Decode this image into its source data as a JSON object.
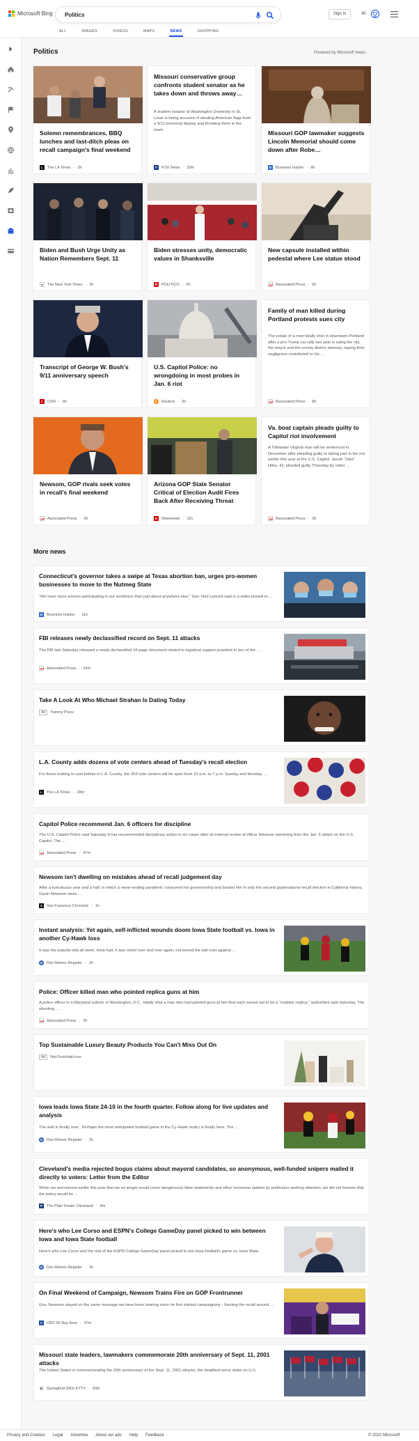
{
  "header": {
    "logo_text": "Microsoft Bing",
    "search_value": "Politics",
    "sign_in": "Sign in",
    "rewards_count": "40",
    "tabs": [
      {
        "label": "ALL"
      },
      {
        "label": "IMAGES"
      },
      {
        "label": "VIDEOS"
      },
      {
        "label": "MAPS"
      },
      {
        "label": "NEWS"
      },
      {
        "label": "SHOPPING"
      }
    ],
    "active_tab": "NEWS"
  },
  "sidebar": {
    "items": [
      "expand-icon",
      "home-icon",
      "tools-icon",
      "flag-icon",
      "location-icon",
      "globe-icon",
      "chart-icon",
      "rocket-icon",
      "film-icon",
      "bank-icon",
      "card-icon"
    ]
  },
  "main": {
    "section_title": "Politics",
    "powered_by": "Powered by Microsoft News",
    "more_title": "More news"
  },
  "cards": [
    {
      "title": "Solemn remembrances, BBQ lunches and last-ditch pleas on recall campaign's final weekend",
      "source": "The LA Times",
      "time": "2h"
    },
    {
      "title": "Missouri conservative group confronts student senator as he takes down and throws away…",
      "desc": "A student senator at Washington University in St. Louis is being accused of stealing American flags from a 9/11 memorial display and throwing them in the trash.",
      "source": "FOX News",
      "time": "33m"
    },
    {
      "title": "Missouri GOP lawmaker suggests Lincoln Memorial should come down after Robe…",
      "source": "Business Insider",
      "time": "9h"
    },
    {
      "title": "Biden and Bush Urge Unity as Nation Remembers Sept. 11",
      "source": "The New York Times",
      "time": "3h"
    },
    {
      "title": "Biden stresses unity, democratic values in Shanksville",
      "source": "POLITICO",
      "time": "6h"
    },
    {
      "title": "New capsule installed within pedestal where Lee statue stood",
      "source": "Associated Press",
      "time": "9h"
    },
    {
      "title": "Transcript of George W. Bush's 9/11 anniversary speech",
      "source": "CNN",
      "time": "9h"
    },
    {
      "title": "U.S. Capitol Police: no wrongdoing in most probes in Jan. 6 riot",
      "source": "Reuters",
      "time": "2h"
    },
    {
      "title": "Family of man killed during Portland protests sues city",
      "desc": "The estate of a man fatally shot in downtown Portland after a pro-Trump car rally last year is suing the city, the mayor and the county district attorney, saying their negligence contributed to his …",
      "source": "Associated Press",
      "time": "8h"
    },
    {
      "title": "Newsom, GOP rivals seek votes in recall's final weekend",
      "source": "Associated Press",
      "time": "3h"
    },
    {
      "title": "Arizona GOP State Senator Critical of Election Audit Fires Back After Receiving Threat",
      "source": "Newsweek",
      "time": "11h"
    },
    {
      "title": "Va. boat captain pleads guilty to Capitol riot involvement",
      "desc": "A Tidewater Virginia man will be sentenced in December after pleading guilty to taking part in the riot earlier this year at the U.S. Capitol. Jacob \"Jake\" Hiles, 42, pleaded guilty Thursday by video …",
      "source": "Associated Press",
      "time": "3h"
    }
  ],
  "more_news": [
    {
      "title": "Connecticut's governor takes a swipe at Texas abortion ban, urges pro-women businesses to move to the Nutmeg State",
      "desc": "\"We have more women participating in our workforce than just about anywhere else,\" Gov. Ned Lamont said in a video posted to …",
      "source": "Business Insider",
      "time": "11h"
    },
    {
      "title": "FBI releases newly declassified record on Sept. 11 attacks",
      "desc": "The FBI late Saturday released a newly declassified 16-page document related to logistical support provided to two of the …",
      "source": "Associated Press",
      "time": "14m"
    },
    {
      "title": "Take A Look At Who Michael Strahan Is Dating Today",
      "ad": "Ad",
      "source": "Yummy Press"
    },
    {
      "title": "L.A. County adds dozens of vote centers ahead of Tuesday's recall election",
      "desc": "For those looking to cast ballots in L.A. County, the 253 vote centers will be open from 10 a.m. to 7 p.m. Sunday and Monday. …",
      "source": "The LA Times",
      "time": "28m"
    },
    {
      "title": "Capitol Police recommend Jan. 6 officers for discipline",
      "desc": "The U.S. Capitol Police said Saturday it has recommended disciplinary action in six cases after an internal review of officer behavior stemming from the Jan. 6 attack on the U.S. Capitol. The …",
      "source": "Associated Press",
      "time": "47m"
    },
    {
      "title": "Newsom isn't dwelling on mistakes ahead of recall judgement day",
      "desc": "After a tumultuous year and a half, in which a never-ending pandemic consumed his governorship and landed him in only the second gubernatorial recall election in California history, Gavin Newsom owns …",
      "source": "San Francisco Chronicle",
      "time": "1h"
    },
    {
      "title": "Instant analysis: Yet again, self-inflicted wounds doom Iowa State football vs. Iowa in another Cy-Hawk loss",
      "desc": "It was the popular stat all week. Iowa had, it was noted over and over again, not turned the ball over against …",
      "source": "Des Moines Register",
      "time": "2h"
    },
    {
      "title": "Police: Officer killed man who pointed replica guns at him",
      "desc": "A police officer in a Maryland suburb of Washington, D.C., fatally shot a man who had pointed guns at him that each turned out to be a \"realistic replica,\" authorities said Saturday. The shooting …",
      "source": "Associated Press",
      "time": "2h"
    },
    {
      "title": "Top Sustainable Luxury Beauty Products You Can't Miss Out On",
      "ad": "Ad",
      "source": "NonToxicHairLove"
    },
    {
      "title": "Iowa leads Iowa State 24-10 in the fourth quarter. Follow along for live updates and analysis",
      "desc": "The wait is finally over.. Perhaps the most anticipated football game in the Cy-Hawk rivalry is finally here. The …",
      "source": "Des Moines Register",
      "time": "2h"
    },
    {
      "title": "Cleveland's media rejected bogus claims about mayoral candidates, so anonymous, well-funded snipers mailed it directly to voters: Letter from the Editor",
      "desc": "When we announced earlier this year that we no longer would cover dangerously false statements and other nonsense spoken by politicians seeking attention, we did not foresee that the policy would be …",
      "source": "The Plain Dealer Cleveland",
      "time": "8m"
    },
    {
      "title": "Here's who Lee Corso and ESPN's College GameDay panel picked to win between Iowa and Iowa State football",
      "desc": "Here's who Lee Corso and the rest of the ESPN College GameDay panel picked to win Iowa football's game vs. Iowa State.",
      "source": "Des Moines Register",
      "time": "3h"
    },
    {
      "title": "On Final Weekend of Campaign, Newsom Trains Fire on GOP Frontrunner",
      "desc": "Gov. Newsom stayed on the same message we have been hearing since he first started campaigning – framing the recall around …",
      "source": "CBS SF Bay Area",
      "time": "37m"
    },
    {
      "title": "Missouri state leaders, lawmakers commemorate 20th anniversary of Sept. 11, 2001 attacks",
      "desc": "The United States is commemorating the 20th anniversary of the Sept. 11, 2001 attacks, the deadliest terror strike on U.S.",
      "source": "Springfield (MO) KYTV",
      "time": "43m"
    }
  ],
  "footer": {
    "links": [
      "Privacy and Cookies",
      "Legal",
      "Advertise",
      "About our ads",
      "Help",
      "Feedback"
    ],
    "copyright": "© 2021 Microsoft"
  },
  "colors": {
    "accent": "#174ae4",
    "page_bg": "#f7f7f7"
  }
}
